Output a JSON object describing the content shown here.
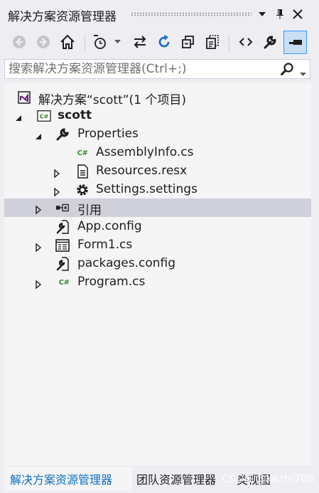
{
  "window": {
    "title": "解决方案资源管理器",
    "buttons": [
      "dropdown-icon",
      "pin-icon",
      "close-icon"
    ]
  },
  "toolbar": {
    "tools": [
      "back-icon",
      "forward-icon",
      "home-icon",
      "pending-changes-filter-icon",
      "sync-icon",
      "refresh-icon",
      "collapse-all-icon",
      "show-all-files-icon",
      "view-code-icon",
      "properties-icon",
      "preview-selected-icon"
    ]
  },
  "search": {
    "placeholder": "搜索解决方案资源管理器(Ctrl+;)"
  },
  "tree": {
    "solution": "解决方案“scott”(1 个项目)",
    "project": "scott",
    "properties": "Properties",
    "assemblyinfo": "AssemblyInfo.cs",
    "resources": "Resources.resx",
    "settings": "Settings.settings",
    "references": "引用",
    "appconfig": "App.config",
    "form1": "Form1.cs",
    "packages": "packages.config",
    "program": "Program.cs"
  },
  "tabs": {
    "solution_explorer": "解决方案资源管理器",
    "team_explorer": "团队资源管理器",
    "class_view": "类视图"
  },
  "watermark": "CSDN @kezhi708",
  "colors": {
    "accent": "#0e70c0",
    "selected_row": "#cfd0da",
    "csharp_green": "#388a34",
    "vs_purple": "#68217a"
  }
}
